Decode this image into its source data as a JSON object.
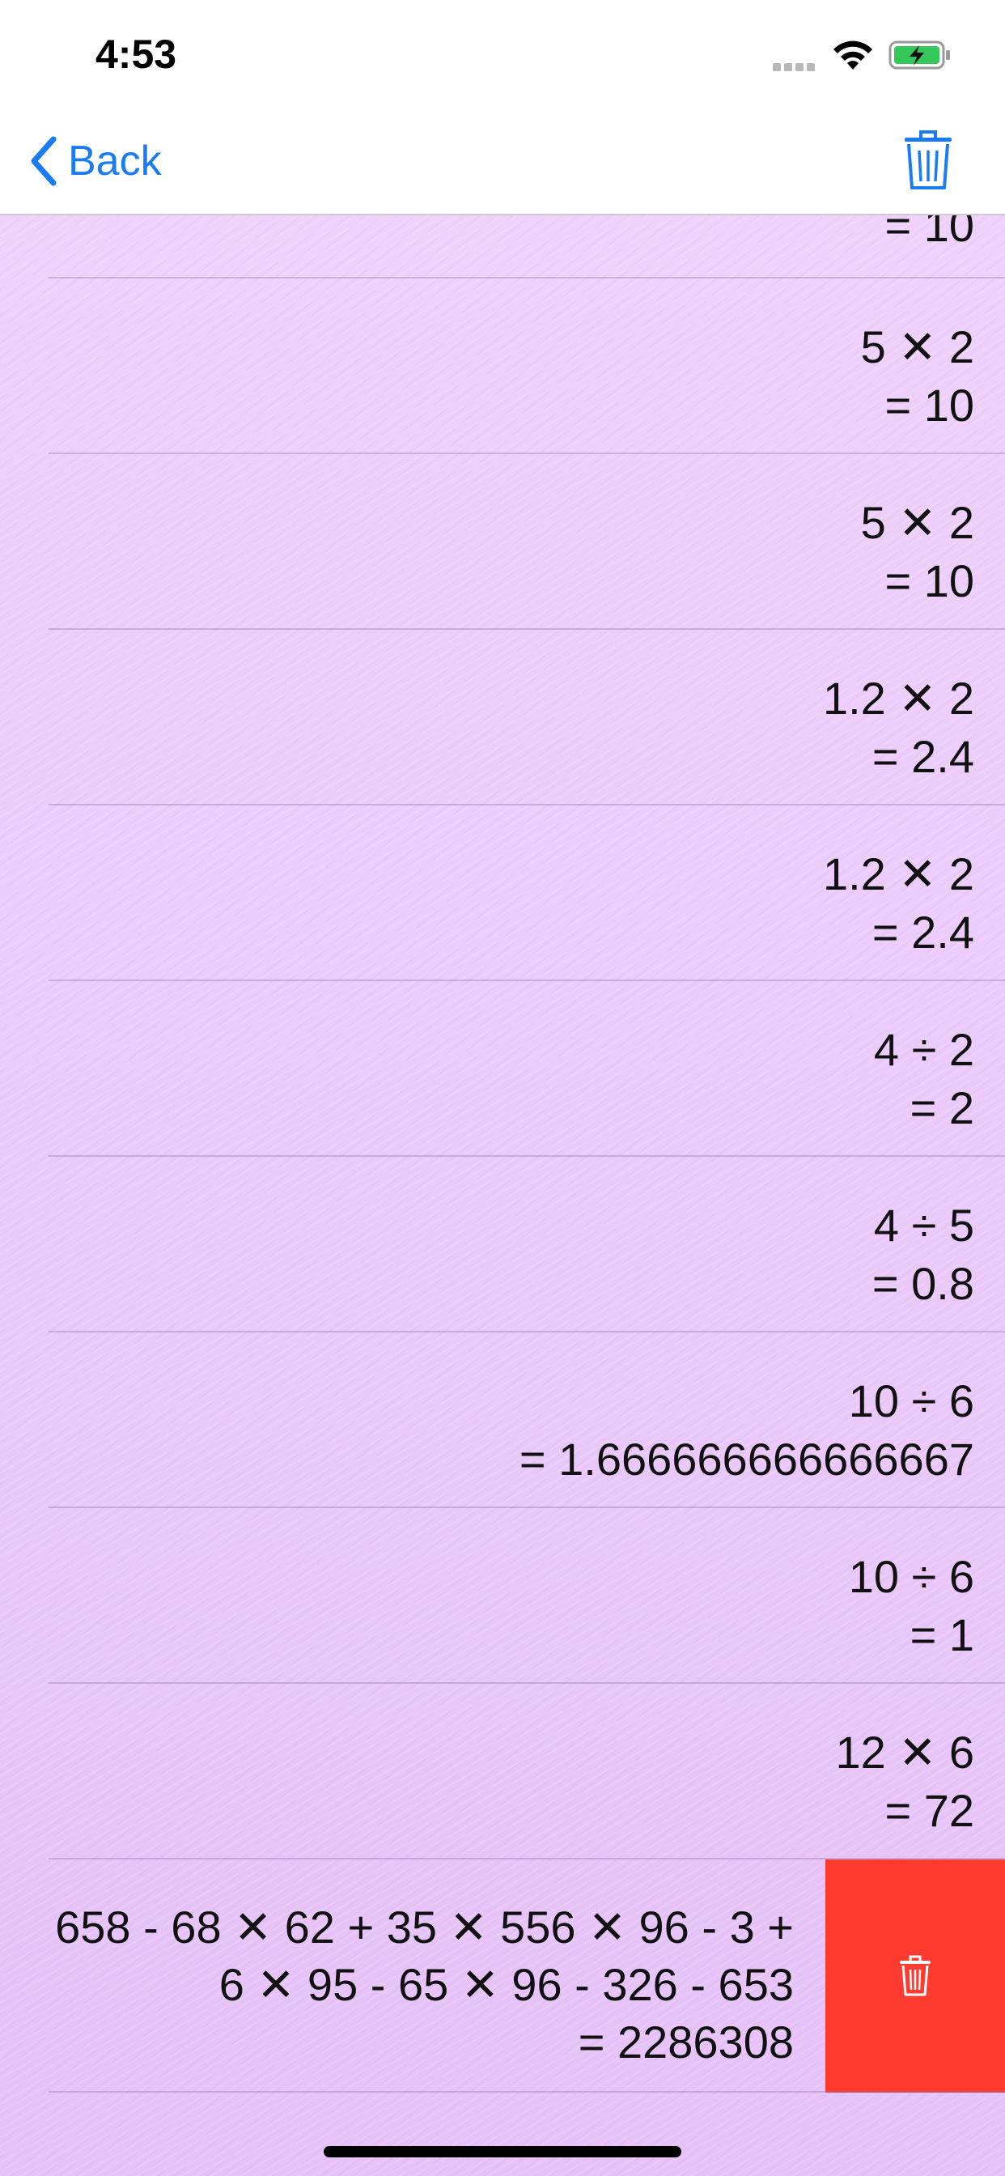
{
  "status_bar": {
    "time": "4:53"
  },
  "nav": {
    "back_label": "Back"
  },
  "top_partial": {
    "result": "= 10"
  },
  "rows": [
    {
      "expr": "5 ✕ 2",
      "result": "= 10"
    },
    {
      "expr": "5 ✕ 2",
      "result": "= 10"
    },
    {
      "expr": "1.2 ✕ 2",
      "result": "= 2.4"
    },
    {
      "expr": "1.2 ✕ 2",
      "result": "= 2.4"
    },
    {
      "expr": "4 ÷ 2",
      "result": "= 2"
    },
    {
      "expr": "4 ÷ 5",
      "result": "= 0.8"
    },
    {
      "expr": "10 ÷ 6",
      "result": "= 1.666666666666667"
    },
    {
      "expr": "10 ÷ 6",
      "result": "= 1"
    },
    {
      "expr": "12 ✕ 6",
      "result": "= 72"
    }
  ],
  "swiped_row": {
    "line1": "658 - 68 ✕ 62 + 35 ✕ 556 ✕ 96 - 3 +",
    "line2": "6 ✕ 95 - 65 ✕ 96 - 326 - 653",
    "line3": "= 2286308"
  },
  "colors": {
    "accent": "#1a7cf5",
    "delete": "#ff3b30",
    "background": "#e9c8f6"
  },
  "icons": {
    "nav_delete": "trash-icon",
    "row_delete": "trash-icon",
    "back": "chevron-left-icon"
  }
}
